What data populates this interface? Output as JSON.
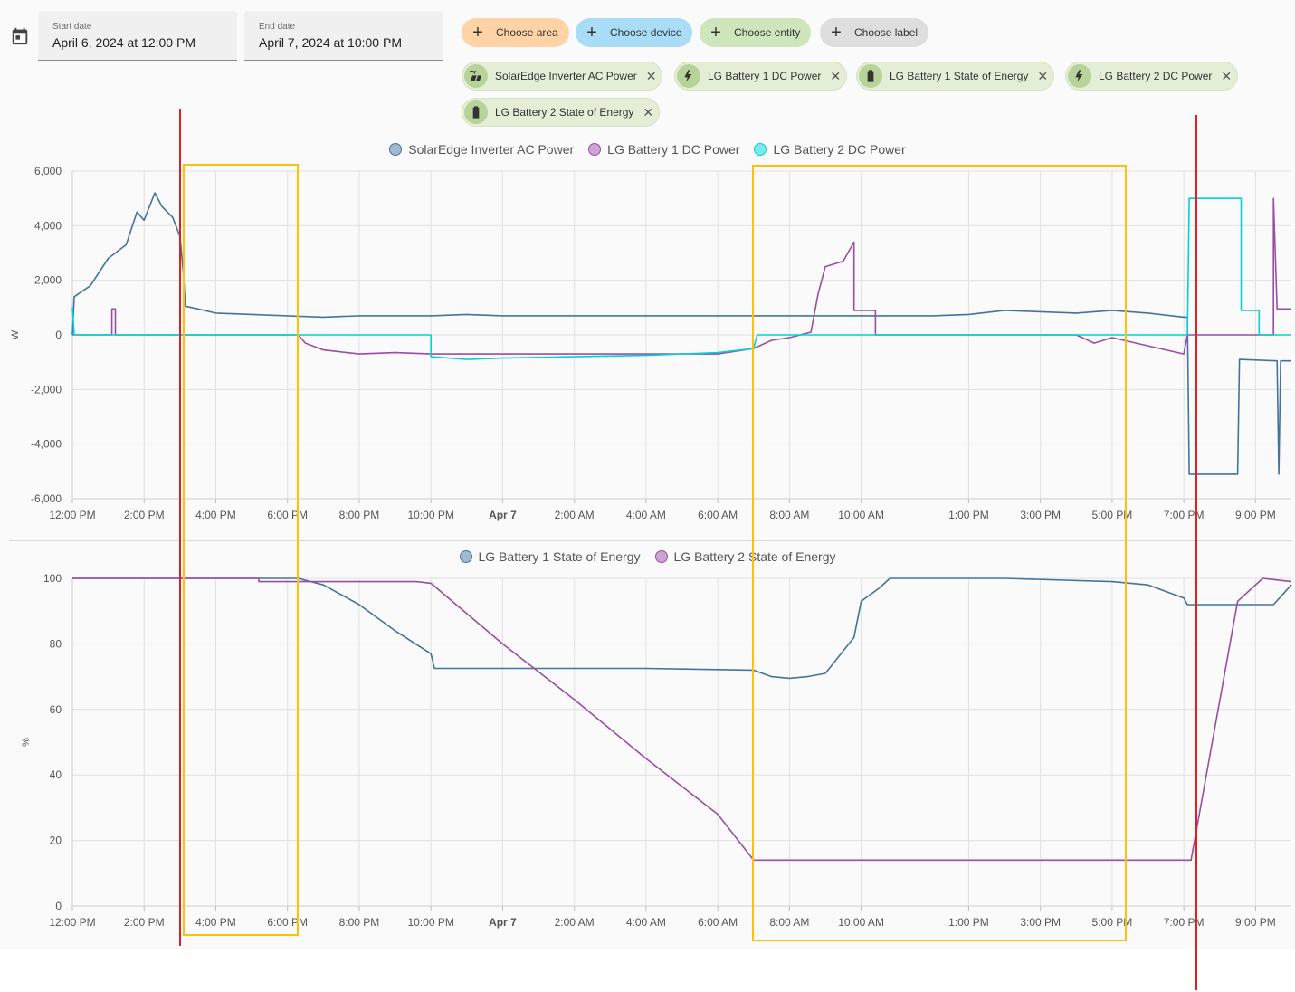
{
  "date_range": {
    "start": {
      "label": "Start date",
      "value": "April 6, 2024 at 12:00 PM"
    },
    "end": {
      "label": "End date",
      "value": "April 7, 2024 at 10:00 PM"
    }
  },
  "target_picker": {
    "choose_area": "Choose area",
    "choose_device": "Choose device",
    "choose_entity": "Choose entity",
    "choose_label": "Choose label"
  },
  "entities": [
    {
      "name": "SolarEdge Inverter AC Power",
      "icon": "solar-power-icon"
    },
    {
      "name": "LG Battery 1 DC Power",
      "icon": "lightning-bolt-icon"
    },
    {
      "name": "LG Battery 1 State of Energy",
      "icon": "battery-icon"
    },
    {
      "name": "LG Battery 2 DC Power",
      "icon": "lightning-bolt-icon"
    },
    {
      "name": "LG Battery 2 State of Energy",
      "icon": "battery-icon"
    }
  ],
  "colors": {
    "solaredge": "#44739e",
    "battery1": "#984ea3",
    "battery2": "#00d2d5",
    "chip_green": "#e4eed7",
    "annotation_red": "#e02020",
    "annotation_yellow": "#ffc107"
  },
  "chart_data": [
    {
      "type": "line",
      "unit_label": "W",
      "ylim": [
        -6000,
        6000
      ],
      "yticks": [
        "6,000",
        "4,000",
        "2,000",
        "0",
        "-2,000",
        "-4,000",
        "-6,000"
      ],
      "xticks": [
        "12:00 PM",
        "2:00 PM",
        "4:00 PM",
        "6:00 PM",
        "8:00 PM",
        "10:00 PM",
        "Apr 7",
        "2:00 AM",
        "4:00 AM",
        "6:00 AM",
        "8:00 AM",
        "10:00 AM",
        "1:00 PM",
        "3:00 PM",
        "5:00 PM",
        "7:00 PM",
        "9:00 PM"
      ],
      "x_hours": [
        0,
        2,
        4,
        6,
        8,
        10,
        12,
        14,
        16,
        18,
        20,
        22,
        25,
        27,
        29,
        31,
        33
      ],
      "series": [
        {
          "name": "SolarEdge Inverter AC Power",
          "color": "#44739e",
          "points": [
            [
              0,
              0
            ],
            [
              0.05,
              1400
            ],
            [
              0.5,
              1800
            ],
            [
              1,
              2800
            ],
            [
              1.5,
              3300
            ],
            [
              1.8,
              4500
            ],
            [
              2,
              4200
            ],
            [
              2.3,
              5200
            ],
            [
              2.5,
              4700
            ],
            [
              2.8,
              4300
            ],
            [
              3,
              3600
            ],
            [
              3.1,
              2200
            ],
            [
              3.15,
              1050
            ],
            [
              3.5,
              950
            ],
            [
              4,
              800
            ],
            [
              5,
              750
            ],
            [
              6,
              700
            ],
            [
              7,
              650
            ],
            [
              8,
              700
            ],
            [
              9,
              700
            ],
            [
              10,
              700
            ],
            [
              11,
              750
            ],
            [
              12,
              700
            ],
            [
              14,
              700
            ],
            [
              16,
              700
            ],
            [
              18,
              700
            ],
            [
              19,
              700
            ],
            [
              20,
              700
            ],
            [
              22,
              700
            ],
            [
              24,
              700
            ],
            [
              25,
              750
            ],
            [
              26,
              900
            ],
            [
              27,
              850
            ],
            [
              28,
              800
            ],
            [
              29,
              900
            ],
            [
              30,
              800
            ],
            [
              31,
              650
            ],
            [
              31.1,
              650
            ],
            [
              31.15,
              -5100
            ],
            [
              32.5,
              -5100
            ],
            [
              32.55,
              -900
            ],
            [
              33.6,
              -950
            ],
            [
              33.65,
              -5100
            ],
            [
              33.7,
              -950
            ],
            [
              34,
              -950
            ]
          ]
        },
        {
          "name": "LG Battery 1 DC Power",
          "color": "#984ea3",
          "points": [
            [
              0,
              0
            ],
            [
              1.1,
              0
            ],
            [
              1.1,
              950
            ],
            [
              1.2,
              950
            ],
            [
              1.2,
              0
            ],
            [
              6.3,
              0
            ],
            [
              6.5,
              -300
            ],
            [
              7,
              -550
            ],
            [
              8,
              -700
            ],
            [
              9,
              -650
            ],
            [
              10,
              -700
            ],
            [
              12,
              -700
            ],
            [
              14,
              -700
            ],
            [
              18,
              -700
            ],
            [
              19,
              -500
            ],
            [
              19.5,
              -200
            ],
            [
              20,
              -100
            ],
            [
              20.6,
              100
            ],
            [
              20.8,
              1500
            ],
            [
              21,
              2500
            ],
            [
              21.5,
              2700
            ],
            [
              21.8,
              3400
            ],
            [
              21.8,
              900
            ],
            [
              22.4,
              900
            ],
            [
              22.4,
              0
            ],
            [
              28,
              0
            ],
            [
              28.5,
              -300
            ],
            [
              29,
              -100
            ],
            [
              30,
              -400
            ],
            [
              31,
              -700
            ],
            [
              31.1,
              0
            ],
            [
              33.5,
              0
            ],
            [
              33.5,
              5000
            ],
            [
              33.6,
              950
            ],
            [
              34,
              950
            ]
          ]
        },
        {
          "name": "LG Battery 2 DC Power",
          "color": "#00d2d5",
          "points": [
            [
              0,
              1000
            ],
            [
              0.05,
              0
            ],
            [
              10,
              0
            ],
            [
              10,
              -800
            ],
            [
              11,
              -900
            ],
            [
              12,
              -850
            ],
            [
              14,
              -800
            ],
            [
              16,
              -750
            ],
            [
              18,
              -650
            ],
            [
              19,
              -500
            ],
            [
              19.1,
              0
            ],
            [
              31.1,
              0
            ],
            [
              31.15,
              5000
            ],
            [
              32.6,
              5000
            ],
            [
              32.6,
              900
            ],
            [
              33.1,
              900
            ],
            [
              33.1,
              0
            ],
            [
              34,
              0
            ]
          ]
        }
      ]
    },
    {
      "type": "line",
      "unit_label": "%",
      "ylim": [
        0,
        100
      ],
      "yticks": [
        "100",
        "80",
        "60",
        "40",
        "20",
        "0"
      ],
      "xticks": [
        "12:00 PM",
        "2:00 PM",
        "4:00 PM",
        "6:00 PM",
        "8:00 PM",
        "10:00 PM",
        "Apr 7",
        "2:00 AM",
        "4:00 AM",
        "6:00 AM",
        "8:00 AM",
        "10:00 AM",
        "1:00 PM",
        "3:00 PM",
        "5:00 PM",
        "7:00 PM",
        "9:00 PM"
      ],
      "x_hours": [
        0,
        2,
        4,
        6,
        8,
        10,
        12,
        14,
        16,
        18,
        20,
        22,
        25,
        27,
        29,
        31,
        33
      ],
      "series": [
        {
          "name": "LG Battery 1 State of Energy",
          "color": "#44739e",
          "points": [
            [
              0,
              100
            ],
            [
              6.3,
              100
            ],
            [
              7,
              98
            ],
            [
              8,
              92
            ],
            [
              9,
              84
            ],
            [
              10,
              77
            ],
            [
              10.1,
              72.5
            ],
            [
              16,
              72.5
            ],
            [
              19,
              72
            ],
            [
              19.5,
              70
            ],
            [
              20,
              69.5
            ],
            [
              20.5,
              70
            ],
            [
              21,
              71
            ],
            [
              21.8,
              82
            ],
            [
              22,
              93
            ],
            [
              22.5,
              97
            ],
            [
              22.8,
              100
            ],
            [
              26,
              100
            ],
            [
              29,
              99
            ],
            [
              30,
              98
            ],
            [
              31,
              94
            ],
            [
              31.1,
              92
            ],
            [
              33.5,
              92
            ],
            [
              34,
              98
            ]
          ]
        },
        {
          "name": "LG Battery 2 State of Energy",
          "color": "#984ea3",
          "points": [
            [
              0,
              100
            ],
            [
              5.2,
              100
            ],
            [
              5.2,
              99
            ],
            [
              9.6,
              99
            ],
            [
              10,
              98.5
            ],
            [
              12,
              80
            ],
            [
              14,
              63
            ],
            [
              16,
              45
            ],
            [
              18,
              28
            ],
            [
              19,
              14
            ],
            [
              31,
              14
            ],
            [
              31.2,
              14
            ],
            [
              32.5,
              93
            ],
            [
              33.2,
              100
            ],
            [
              34,
              99
            ]
          ]
        }
      ]
    }
  ]
}
